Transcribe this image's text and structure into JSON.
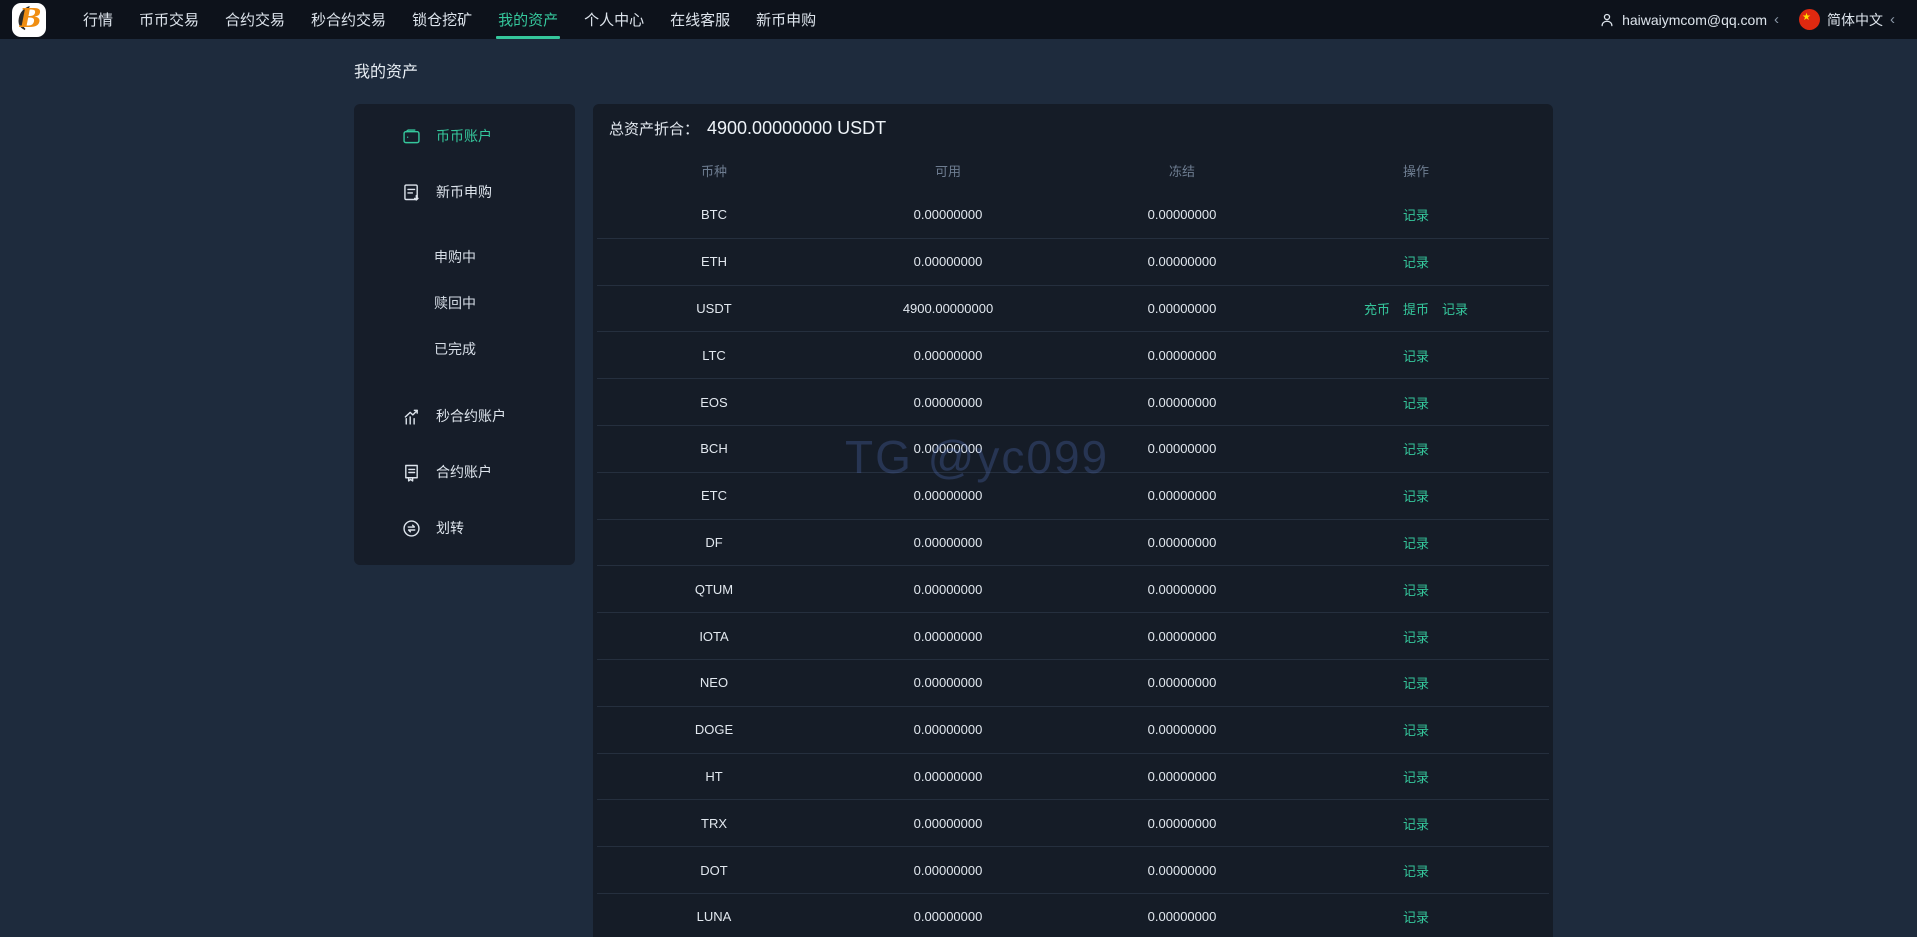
{
  "header": {
    "logo": {
      "letter": "B",
      "brand_color": "#f08e12"
    },
    "nav_items": [
      {
        "key": "market",
        "label": "行情",
        "active": false
      },
      {
        "key": "spot-trade",
        "label": "币币交易",
        "active": false
      },
      {
        "key": "contract-trade",
        "label": "合约交易",
        "active": false
      },
      {
        "key": "second-contract",
        "label": "秒合约交易",
        "active": false
      },
      {
        "key": "lock-mining",
        "label": "锁仓挖矿",
        "active": false
      },
      {
        "key": "my-assets",
        "label": "我的资产",
        "active": true
      },
      {
        "key": "user-center",
        "label": "个人中心",
        "active": false
      },
      {
        "key": "online-support",
        "label": "在线客服",
        "active": false
      },
      {
        "key": "new-coin",
        "label": "新币申购",
        "active": false
      }
    ],
    "user": {
      "email": "haiwaiymcom@qq.com",
      "chevron": "‹"
    },
    "language": {
      "label": "简体中文",
      "chevron": "‹",
      "flag_icon": "china-flag-icon"
    }
  },
  "page": {
    "title": "我的资产"
  },
  "sidebar": {
    "items": [
      {
        "key": "coin-account",
        "label": "币币账户",
        "type": "item",
        "icon": "wallet-icon",
        "active": true
      },
      {
        "key": "new-coin-subscribe",
        "label": "新币申购",
        "type": "item",
        "icon": "subscribe-icon",
        "active": false
      },
      {
        "key": "subscribing",
        "label": "申购中",
        "type": "sub"
      },
      {
        "key": "redeeming",
        "label": "赎回中",
        "type": "sub"
      },
      {
        "key": "completed",
        "label": "已完成",
        "type": "sub"
      },
      {
        "key": "second-contract-account",
        "label": "秒合约账户",
        "type": "item",
        "icon": "chart-icon",
        "active": false
      },
      {
        "key": "contract-account",
        "label": "合约账户",
        "type": "item",
        "icon": "contract-icon",
        "active": false
      },
      {
        "key": "transfer",
        "label": "划转",
        "type": "item",
        "icon": "transfer-icon",
        "active": false
      }
    ]
  },
  "assets": {
    "total_label": "总资产折合：",
    "total_value": "4900.00000000 USDT",
    "columns": [
      "币种",
      "可用",
      "冻结",
      "操作"
    ],
    "rows": [
      {
        "coin": "BTC",
        "available": "0.00000000",
        "frozen": "0.00000000",
        "actions": [
          "记录"
        ]
      },
      {
        "coin": "ETH",
        "available": "0.00000000",
        "frozen": "0.00000000",
        "actions": [
          "记录"
        ]
      },
      {
        "coin": "USDT",
        "available": "4900.00000000",
        "frozen": "0.00000000",
        "actions": [
          "充币",
          "提币",
          "记录"
        ]
      },
      {
        "coin": "LTC",
        "available": "0.00000000",
        "frozen": "0.00000000",
        "actions": [
          "记录"
        ]
      },
      {
        "coin": "EOS",
        "available": "0.00000000",
        "frozen": "0.00000000",
        "actions": [
          "记录"
        ]
      },
      {
        "coin": "BCH",
        "available": "0.00000000",
        "frozen": "0.00000000",
        "actions": [
          "记录"
        ]
      },
      {
        "coin": "ETC",
        "available": "0.00000000",
        "frozen": "0.00000000",
        "actions": [
          "记录"
        ]
      },
      {
        "coin": "DF",
        "available": "0.00000000",
        "frozen": "0.00000000",
        "actions": [
          "记录"
        ]
      },
      {
        "coin": "QTUM",
        "available": "0.00000000",
        "frozen": "0.00000000",
        "actions": [
          "记录"
        ]
      },
      {
        "coin": "IOTA",
        "available": "0.00000000",
        "frozen": "0.00000000",
        "actions": [
          "记录"
        ]
      },
      {
        "coin": "NEO",
        "available": "0.00000000",
        "frozen": "0.00000000",
        "actions": [
          "记录"
        ]
      },
      {
        "coin": "DOGE",
        "available": "0.00000000",
        "frozen": "0.00000000",
        "actions": [
          "记录"
        ]
      },
      {
        "coin": "HT",
        "available": "0.00000000",
        "frozen": "0.00000000",
        "actions": [
          "记录"
        ]
      },
      {
        "coin": "TRX",
        "available": "0.00000000",
        "frozen": "0.00000000",
        "actions": [
          "记录"
        ]
      },
      {
        "coin": "DOT",
        "available": "0.00000000",
        "frozen": "0.00000000",
        "actions": [
          "记录"
        ]
      },
      {
        "coin": "LUNA",
        "available": "0.00000000",
        "frozen": "0.00000000",
        "actions": [
          "记录"
        ]
      }
    ]
  },
  "watermark": "TG @yc099",
  "colors": {
    "accent_green": "#35c79c",
    "nav_bg": "#0d121b",
    "page_bg": "#1e2b3d",
    "card_bg": "#151c27",
    "flag_red": "#de2910",
    "flag_star_yellow": "#ffde00"
  }
}
